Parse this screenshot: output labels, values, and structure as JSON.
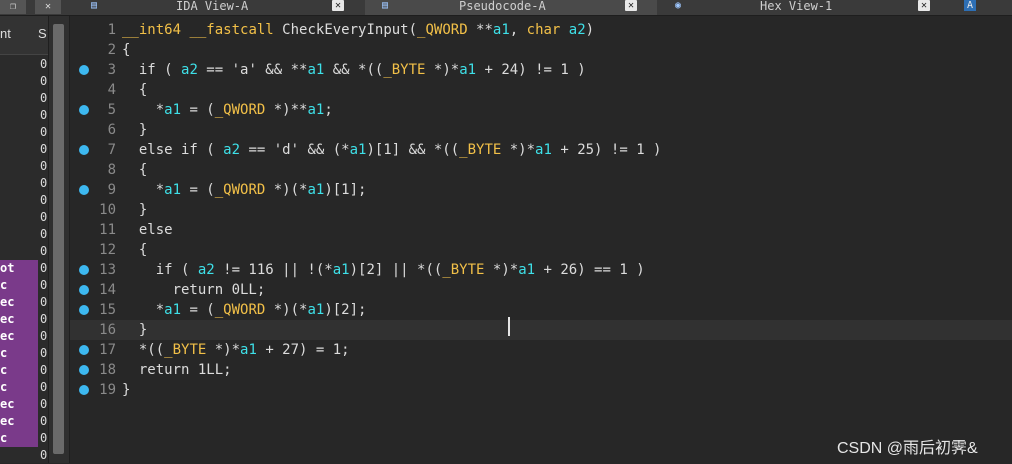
{
  "tabs": [
    {
      "label": "IDA View-A",
      "icon": "document-icon",
      "active": false
    },
    {
      "label": "Pseudocode-A",
      "icon": "document-icon",
      "active": true
    },
    {
      "label": "Hex View-1",
      "icon": "hex-icon",
      "active": false
    },
    {
      "label": "A",
      "icon": "structures-icon",
      "active": false
    }
  ],
  "left_panel": {
    "col1_header": "nt",
    "col2_header": "S",
    "rows": [
      {
        "name": "",
        "val": "0",
        "hl": false
      },
      {
        "name": "",
        "val": "0",
        "hl": false
      },
      {
        "name": "",
        "val": "0",
        "hl": false
      },
      {
        "name": "",
        "val": "0",
        "hl": false
      },
      {
        "name": "",
        "val": "0",
        "hl": false
      },
      {
        "name": "",
        "val": "0",
        "hl": false
      },
      {
        "name": "",
        "val": "0",
        "hl": false
      },
      {
        "name": "",
        "val": "0",
        "hl": false
      },
      {
        "name": "",
        "val": "0",
        "hl": false
      },
      {
        "name": "",
        "val": "0",
        "hl": false
      },
      {
        "name": "",
        "val": "0",
        "hl": false
      },
      {
        "name": "",
        "val": "0",
        "hl": false
      },
      {
        "name": "ot",
        "val": "0",
        "hl": true
      },
      {
        "name": "c",
        "val": "0",
        "hl": true
      },
      {
        "name": "ec",
        "val": "0",
        "hl": true
      },
      {
        "name": "ec",
        "val": "0",
        "hl": true
      },
      {
        "name": "ec",
        "val": "0",
        "hl": true
      },
      {
        "name": "c",
        "val": "0",
        "hl": true
      },
      {
        "name": "c",
        "val": "0",
        "hl": true
      },
      {
        "name": "c",
        "val": "0",
        "hl": true
      },
      {
        "name": "ec",
        "val": "0",
        "hl": true
      },
      {
        "name": "ec",
        "val": "0",
        "hl": true
      },
      {
        "name": "c",
        "val": "0",
        "hl": true
      },
      {
        "name": "",
        "val": "0",
        "hl": false
      }
    ]
  },
  "code": {
    "lines": [
      {
        "num": "1",
        "bp": false,
        "html_text": "__int64 __fastcall CheckEveryInput(_QWORD **a1, char a2)"
      },
      {
        "num": "2",
        "bp": false,
        "html_text": "{"
      },
      {
        "num": "3",
        "bp": true,
        "html_text": "  if ( a2 == 'a' && **a1 && *((_BYTE *)*a1 + 24) != 1 )"
      },
      {
        "num": "4",
        "bp": false,
        "html_text": "  {"
      },
      {
        "num": "5",
        "bp": true,
        "html_text": "    *a1 = (_QWORD *)**a1;"
      },
      {
        "num": "6",
        "bp": false,
        "html_text": "  }"
      },
      {
        "num": "7",
        "bp": true,
        "html_text": "  else if ( a2 == 'd' && (*a1)[1] && *((_BYTE *)*a1 + 25) != 1 )"
      },
      {
        "num": "8",
        "bp": false,
        "html_text": "  {"
      },
      {
        "num": "9",
        "bp": true,
        "html_text": "    *a1 = (_QWORD *)(*a1)[1];"
      },
      {
        "num": "10",
        "bp": false,
        "html_text": "  }"
      },
      {
        "num": "11",
        "bp": false,
        "html_text": "  else"
      },
      {
        "num": "12",
        "bp": false,
        "html_text": "  {"
      },
      {
        "num": "13",
        "bp": true,
        "html_text": "    if ( a2 != 116 || !(*a1)[2] || *((_BYTE *)*a1 + 26) == 1 )"
      },
      {
        "num": "14",
        "bp": true,
        "html_text": "      return 0LL;"
      },
      {
        "num": "15",
        "bp": true,
        "html_text": "    *a1 = (_QWORD *)(*a1)[2];"
      },
      {
        "num": "16",
        "bp": false,
        "html_text": "  }",
        "current": true
      },
      {
        "num": "17",
        "bp": true,
        "html_text": "  *((_BYTE *)*a1 + 27) = 1;"
      },
      {
        "num": "18",
        "bp": true,
        "html_text": "  return 1LL;"
      },
      {
        "num": "19",
        "bp": true,
        "html_text": "}"
      }
    ]
  },
  "watermark": "CSDN @雨后初霁&",
  "colors": {
    "background": "#272727",
    "type_keyword": "#f2c048",
    "identifier": "#3ee0e8",
    "breakpoint": "#3db8f0",
    "segment_highlight": "#7a3a8a"
  }
}
